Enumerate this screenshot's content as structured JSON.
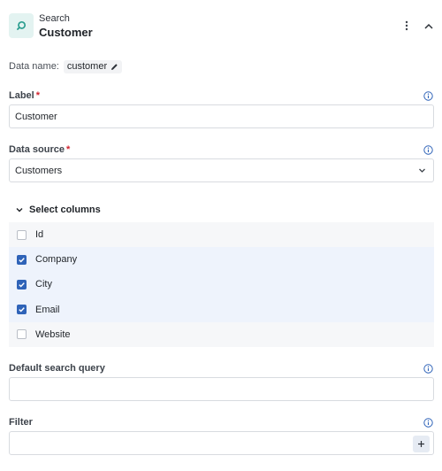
{
  "header": {
    "subtitle": "Search",
    "title": "Customer",
    "icon": "search-widget-icon",
    "accent": "#2a9d8f"
  },
  "data_name": {
    "label": "Data name:",
    "value": "customer"
  },
  "label_field": {
    "label": "Label",
    "required_mark": "*",
    "value": "Customer"
  },
  "data_source": {
    "label": "Data source",
    "required_mark": "*",
    "value": "Customers"
  },
  "columns": {
    "toggle_label": "Select columns",
    "items": [
      {
        "name": "Id",
        "checked": false
      },
      {
        "name": "Company",
        "checked": true
      },
      {
        "name": "City",
        "checked": true
      },
      {
        "name": "Email",
        "checked": true
      },
      {
        "name": "Website",
        "checked": false
      }
    ]
  },
  "default_query": {
    "label": "Default search query",
    "value": ""
  },
  "filter": {
    "label": "Filter",
    "value": ""
  },
  "colors": {
    "checkbox_checked": "#2f63b8",
    "required": "#d1242f",
    "row_selected_bg": "#eef3fc"
  }
}
